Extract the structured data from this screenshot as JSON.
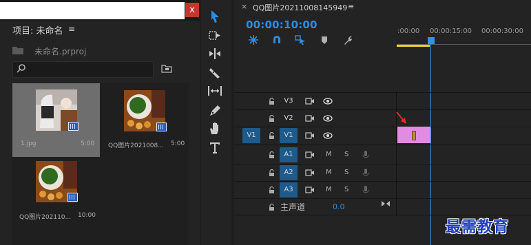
{
  "project_panel": {
    "title": "项目: 未命名",
    "menu": "≡",
    "project_file": "未命名.prproj",
    "search_placeholder": "",
    "close_glyph": "x",
    "clips": [
      {
        "name": "1.jpg",
        "duration": "5:00",
        "selected": true
      },
      {
        "name": "QQ图片2021008...",
        "duration": "5:00",
        "selected": false
      },
      {
        "name": "QQ图片202110...",
        "duration": "10:00",
        "selected": false
      }
    ]
  },
  "tools": [
    "selection-tool",
    "track-select-tool",
    "ripple-edit-tool",
    "razor-tool",
    "slip-tool",
    "pen-tool",
    "hand-tool",
    "type-tool"
  ],
  "timeline": {
    "close_glyph": "×",
    "title": "QQ图片20211008145949",
    "menu": "≡",
    "timecode": "00:00:10:00",
    "ruler_labels": [
      ":00:00",
      "00:00:15:00",
      "00:00:30:00"
    ],
    "video_tracks": [
      {
        "name": "V3",
        "source": "",
        "active": false
      },
      {
        "name": "V2",
        "source": "",
        "active": false
      },
      {
        "name": "V1",
        "source": "V1",
        "active": true
      }
    ],
    "audio_tracks": [
      {
        "name": "A1",
        "mute": "M",
        "solo": "S"
      },
      {
        "name": "A2",
        "mute": "M",
        "solo": "S"
      },
      {
        "name": "A3",
        "mute": "M",
        "solo": "S"
      }
    ],
    "master": {
      "label": "主声道",
      "value": "0.0"
    }
  },
  "watermark": "最需教育",
  "colors": {
    "accent": "#2c8de6",
    "clip": "#e18ce0",
    "track_target": "#1f5a8a",
    "close": "#c0392b"
  }
}
